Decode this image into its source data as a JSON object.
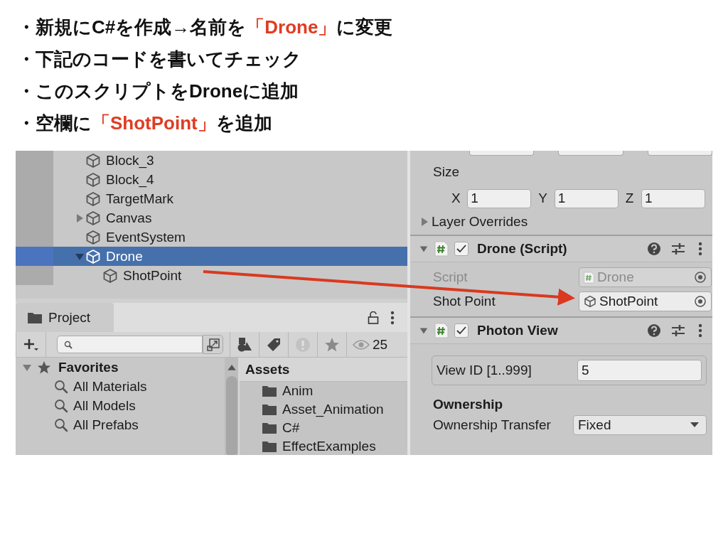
{
  "bullets": [
    {
      "parts": [
        {
          "text": "・新規にC#を作成→名前を",
          "highlight": false
        },
        {
          "text": "「Drone」",
          "highlight": true
        },
        {
          "text": "に変更",
          "highlight": false
        }
      ]
    },
    {
      "parts": [
        {
          "text": "・下記のコードを書いてチェック",
          "highlight": false
        }
      ]
    },
    {
      "parts": [
        {
          "text": "・このスクリプトをDroneに追加",
          "highlight": false
        }
      ]
    },
    {
      "parts": [
        {
          "text": "・空欄に",
          "highlight": false
        },
        {
          "text": "「ShotPoint」",
          "highlight": true
        },
        {
          "text": "を追加",
          "highlight": false
        }
      ]
    }
  ],
  "hierarchy": {
    "items": [
      {
        "label": "Block_3",
        "selected": false
      },
      {
        "label": "Block_4",
        "selected": false
      },
      {
        "label": "TargetMark",
        "selected": false
      },
      {
        "label": "Canvas",
        "selected": false,
        "expanded": false
      },
      {
        "label": "EventSystem",
        "selected": false
      },
      {
        "label": "Drone",
        "selected": true,
        "expanded": true,
        "children": [
          {
            "label": "ShotPoint",
            "selected": false
          }
        ]
      }
    ]
  },
  "project": {
    "tab": "Project",
    "hidden_count": "25",
    "favorites": {
      "label": "Favorites",
      "expanded": true,
      "children": [
        "All Materials",
        "All Models",
        "All Prefabs"
      ]
    },
    "assets": {
      "title": "Assets",
      "items": [
        "Anim",
        "Asset_Animation",
        "C#",
        "EffectExamples"
      ]
    }
  },
  "inspector": {
    "size_label": "Size",
    "size_fields": [
      {
        "axis": "X",
        "value": "1"
      },
      {
        "axis": "Y",
        "value": "1"
      },
      {
        "axis": "Z",
        "value": "1"
      }
    ],
    "layer_overrides": {
      "label": "Layer Overrides",
      "expanded": false
    },
    "components": [
      {
        "kind": "script",
        "title": "Drone (Script)",
        "enabled": true,
        "expanded": true,
        "fields": [
          {
            "label": "Script",
            "value": "Drone",
            "disabled": true,
            "kind": "script"
          },
          {
            "label": "Shot Point",
            "value": "ShotPoint",
            "disabled": false,
            "kind": "object"
          }
        ]
      },
      {
        "kind": "photon",
        "title": "Photon View",
        "enabled": true,
        "expanded": true,
        "view_id": {
          "label": "View ID [1..999]",
          "value": "5"
        },
        "section": "Ownership",
        "dropdown": {
          "label": "Ownership Transfer",
          "value": "Fixed"
        }
      }
    ]
  }
}
